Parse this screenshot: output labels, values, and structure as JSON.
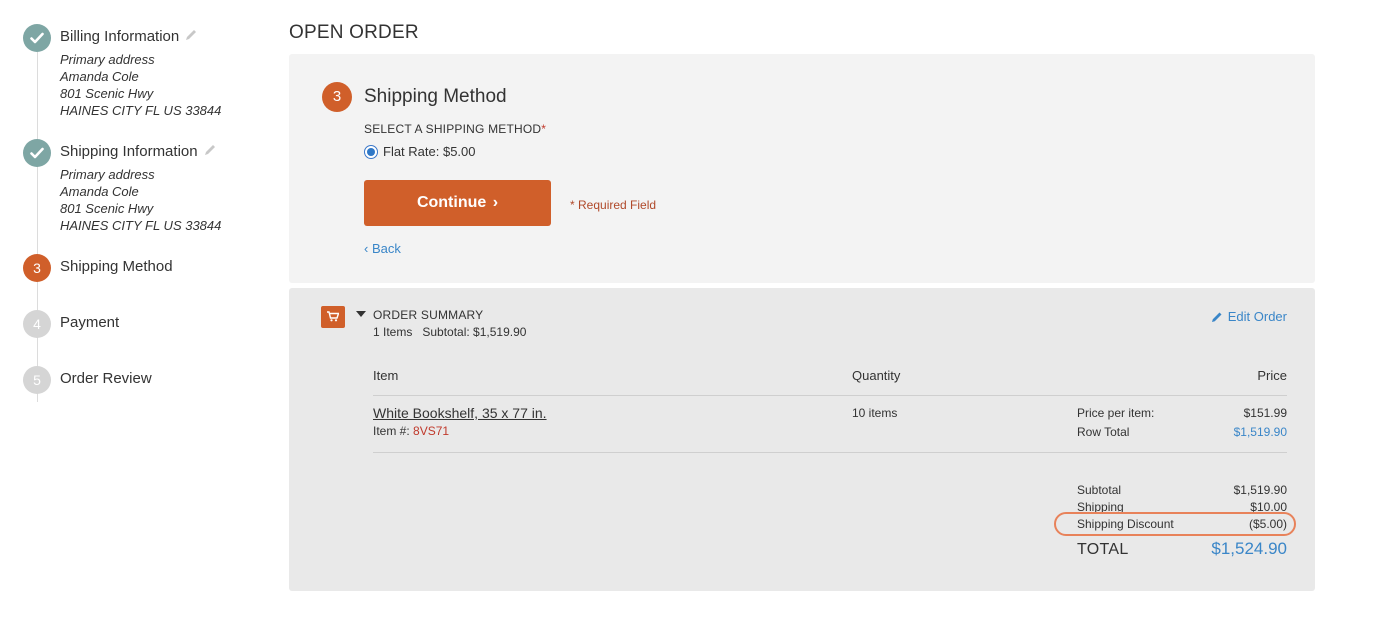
{
  "steps": [
    {
      "number": "",
      "title": "Billing Information",
      "status": "done",
      "editable": true,
      "address": [
        "Primary address",
        "Amanda Cole",
        "801 Scenic Hwy",
        "HAINES CITY FL US 33844"
      ]
    },
    {
      "number": "",
      "title": "Shipping Information",
      "status": "done",
      "editable": true,
      "address": [
        "Primary address",
        "Amanda Cole",
        "801 Scenic Hwy",
        "HAINES CITY FL US 33844"
      ]
    },
    {
      "number": "3",
      "title": "Shipping Method",
      "status": "active"
    },
    {
      "number": "4",
      "title": "Payment",
      "status": "todo"
    },
    {
      "number": "5",
      "title": "Order Review",
      "status": "todo"
    }
  ],
  "page_title": "OPEN ORDER",
  "shipping": {
    "step_number": "3",
    "title": "Shipping Method",
    "select_label": "SELECT A SHIPPING METHOD",
    "required_marker": "*",
    "option_label": "Flat Rate: $5.00",
    "option_selected": true,
    "continue_label": "Continue",
    "continue_chevron": "›",
    "required_note": "* Required Field",
    "back_label": "‹ Back"
  },
  "summary": {
    "title": "ORDER SUMMARY",
    "items_count": "1 Items",
    "subtotal_inline": "Subtotal: $1,519.90",
    "edit_label": "Edit Order",
    "columns": {
      "item": "Item",
      "quantity": "Quantity",
      "price": "Price"
    },
    "item": {
      "name": "White Bookshelf, 35 x 77 in.",
      "sku_label": "Item #:",
      "sku": "8VS71",
      "quantity": "10 items",
      "price_per_item_label": "Price per item:",
      "price_per_item": "$151.99",
      "row_total_label": "Row Total",
      "row_total": "$1,519.90"
    },
    "totals": {
      "subtotal_label": "Subtotal",
      "subtotal": "$1,519.90",
      "shipping_label": "Shipping",
      "shipping": "$10.00",
      "discount_label": "Shipping Discount",
      "discount": "($5.00)",
      "total_label": "TOTAL",
      "total": "$1,524.90"
    }
  },
  "colors": {
    "accent": "#d05f2a",
    "done": "#7ea6a4",
    "link": "#3a86c8",
    "highlight": "#e8825a"
  }
}
